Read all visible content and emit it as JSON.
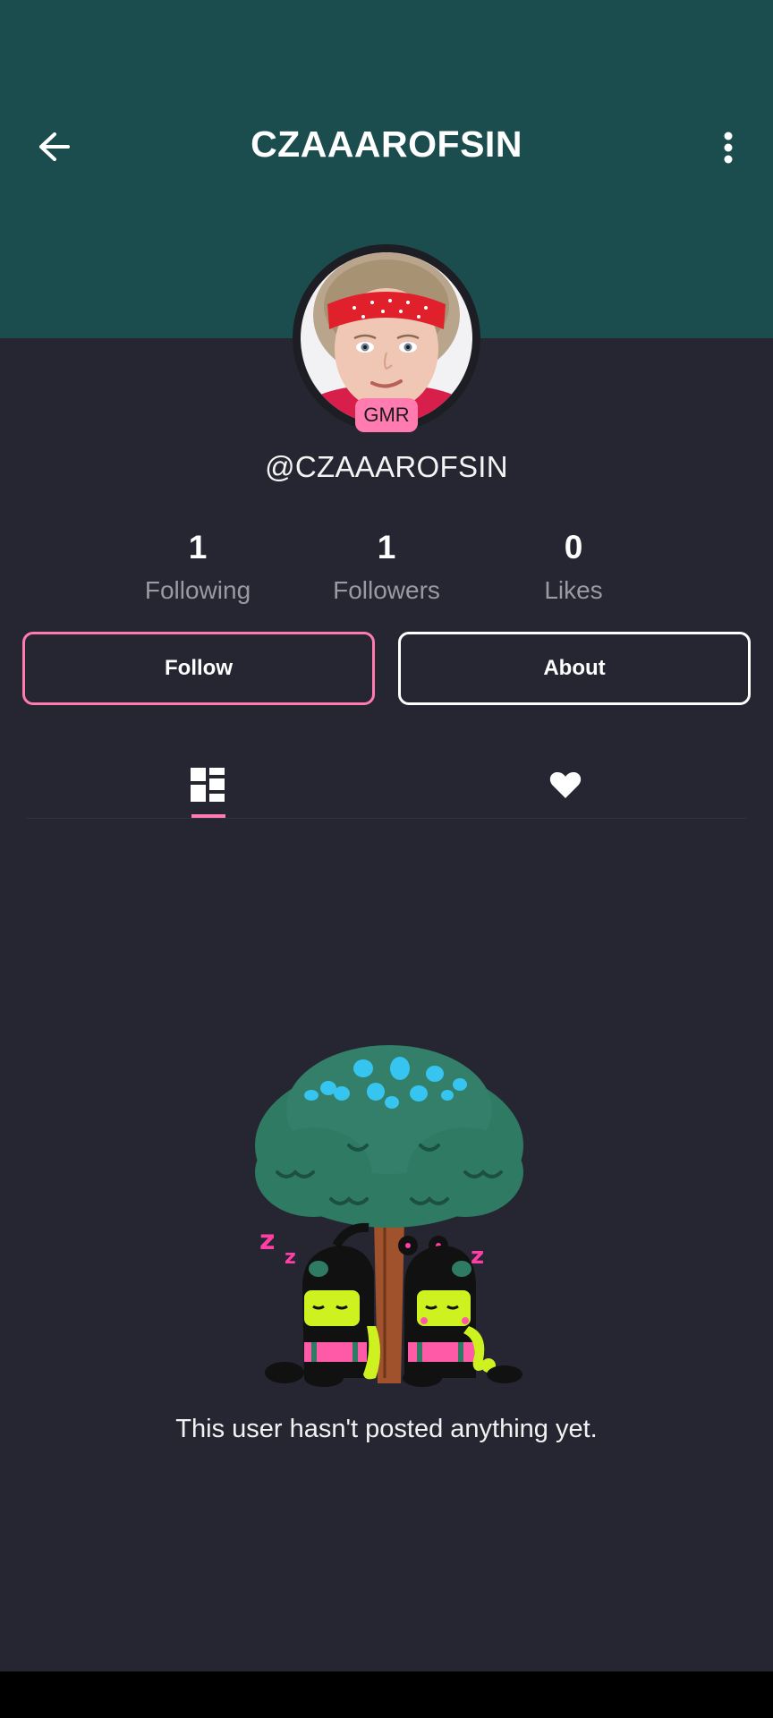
{
  "header": {
    "title": "CZAAAROFSIN",
    "back_icon": "arrow-left-icon",
    "more_icon": "more-vertical-icon",
    "background_color": "#1b4d4e"
  },
  "profile": {
    "avatar_badge": "GMR",
    "handle": "@CZAAAROFSIN"
  },
  "stats": [
    {
      "value": "1",
      "label": "Following"
    },
    {
      "value": "1",
      "label": "Followers"
    },
    {
      "value": "0",
      "label": "Likes"
    }
  ],
  "actions": {
    "follow_label": "Follow",
    "about_label": "About"
  },
  "tabs": [
    {
      "icon": "posts-grid-icon",
      "selected": true
    },
    {
      "icon": "heart-icon",
      "selected": false
    }
  ],
  "empty_state": {
    "message": "This user hasn't posted anything yet."
  },
  "colors": {
    "accent": "#ff7bb0",
    "background": "#262632"
  }
}
